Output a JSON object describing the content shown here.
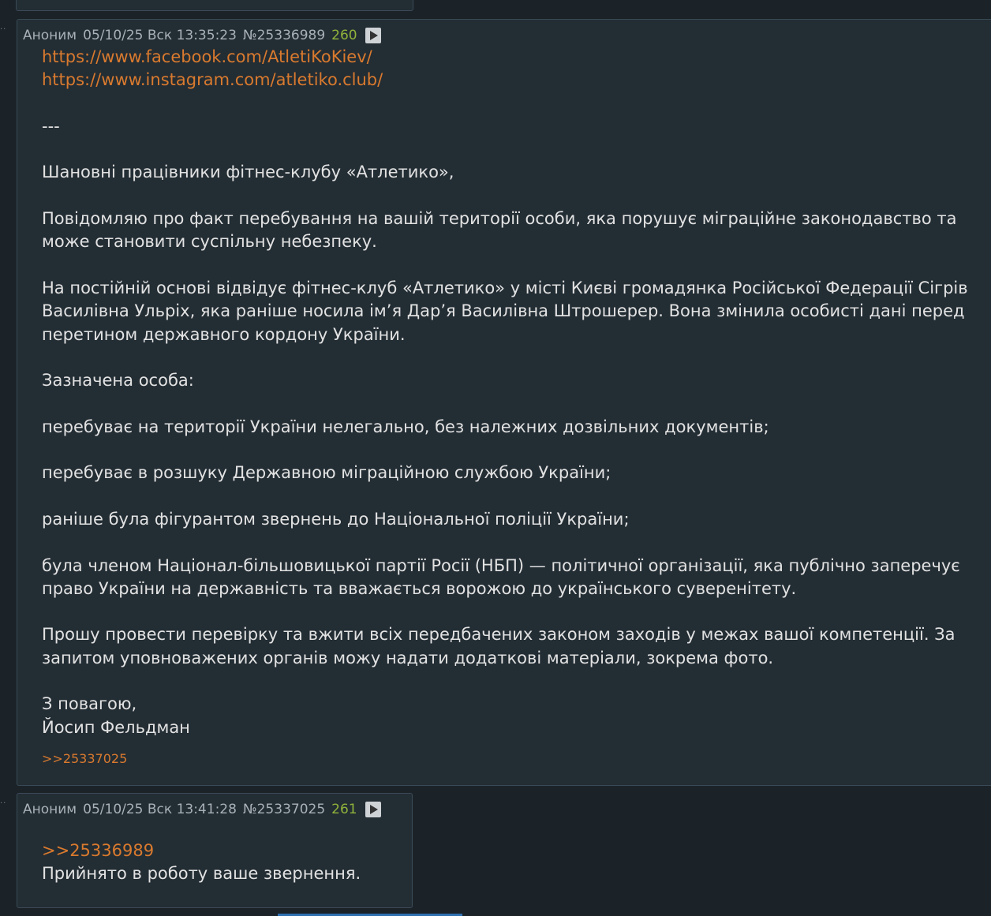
{
  "post1": {
    "author": "Аноним",
    "date": "05/10/25 Вск 13:35:23",
    "number": "№25336989",
    "count": "260",
    "links": [
      "https://www.facebook.com/AtletiKoKiev/",
      "https://www.instagram.com/atletiko.club/"
    ],
    "separator": "---",
    "greeting": "Шановні працівники фітнес-клубу «Атлетико»,",
    "p1": "Повідомляю про факт перебування на вашій території особи, яка порушує міграційне законодавство та може становити суспільну небезпеку.",
    "p2": "На постійній основі відвідує фітнес-клуб «Атлетико» у місті Києві громадянка Російської Федерації Сігрів Василівна Ульріх, яка раніше носила ім’я Дар’я Василівна Штрошерер. Вона змінила особисті дані перед перетином державного кордону України.",
    "p3": "Зазначена особа:",
    "item1": "перебуває на території України нелегально, без належних дозвільних документів;",
    "item2": "перебуває в розшуку Державною міграційною службою України;",
    "item3": "раніше була фігурантом звернень до Національної поліції України;",
    "item4": "була членом Націонал-більшовицької партії Росії (НБП) — політичної організації, яка публічно заперечує право України на державність та вважається ворожою до українського суверенітету.",
    "p4": "Прошу провести перевірку та вжити всіх передбачених законом заходів у межах вашої компетенції. За запитом уповноважених органів можу надати додаткові матеріали, зокрема фото.",
    "sign1": "З повагою,",
    "sign2": "Йосип Фельдман",
    "reply": ">>25337025"
  },
  "post2": {
    "author": "Аноним",
    "date": "05/10/25 Вск 13:41:28",
    "number": "№25337025",
    "count": "261",
    "reply_link": ">>25336989",
    "text": "Прийнято в роботу ваше звернення."
  },
  "colors": {
    "background": "#1b2329",
    "post_background": "#232d34",
    "link": "#d97a2e",
    "count": "#8fb33a"
  }
}
